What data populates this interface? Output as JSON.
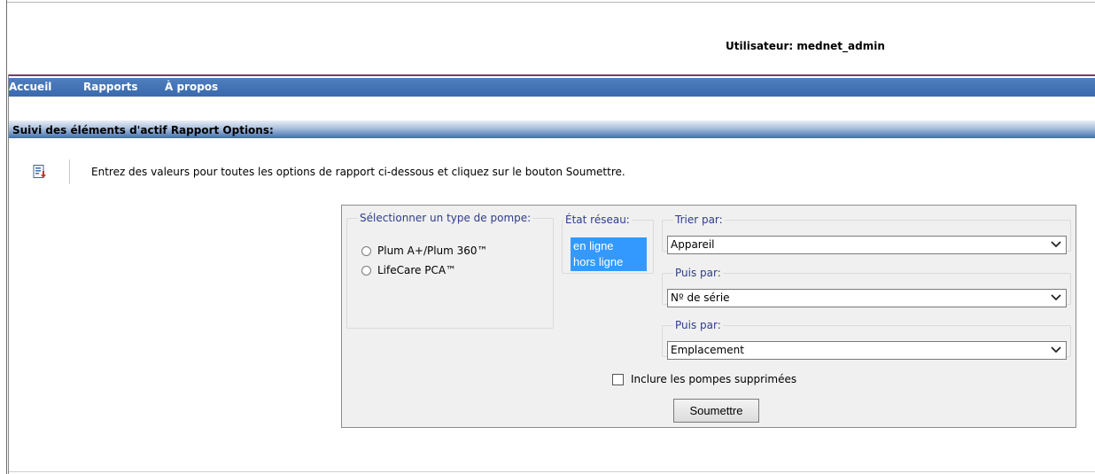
{
  "header": {
    "user_label": "Utilisateur: mednet_admin"
  },
  "nav": {
    "items": [
      {
        "label": "Accueil"
      },
      {
        "label": "Rapports"
      },
      {
        "label": "À propos"
      }
    ]
  },
  "section": {
    "title": "Suivi des éléments d'actif Rapport Options:"
  },
  "instructions": {
    "icon": "report-options-icon",
    "text": "Entrez des valeurs pour toutes les options de rapport ci-dessous et cliquez sur le bouton Soumettre."
  },
  "form": {
    "pump_type": {
      "legend": "Sélectionner un type de pompe:",
      "options": [
        {
          "label": "Plum A+/Plum 360™"
        },
        {
          "label": "LifeCare PCA™"
        }
      ]
    },
    "network_state": {
      "legend": "État réseau:",
      "options": [
        {
          "label": "en ligne"
        },
        {
          "label": "hors ligne"
        }
      ]
    },
    "sort": [
      {
        "legend": "Trier par:",
        "value": "Appareil"
      },
      {
        "legend": "Puis par:",
        "value": "Nº de série"
      },
      {
        "legend": "Puis par:",
        "value": "Emplacement"
      }
    ],
    "include_deleted_label": "Inclure les pompes supprimées",
    "submit_label": "Soumettre"
  },
  "colors": {
    "nav_bar": "#3a6aad",
    "accent_purple": "#6b3f7a",
    "listbox_selection": "#3399ff",
    "legend_text": "#2f3d8a"
  }
}
